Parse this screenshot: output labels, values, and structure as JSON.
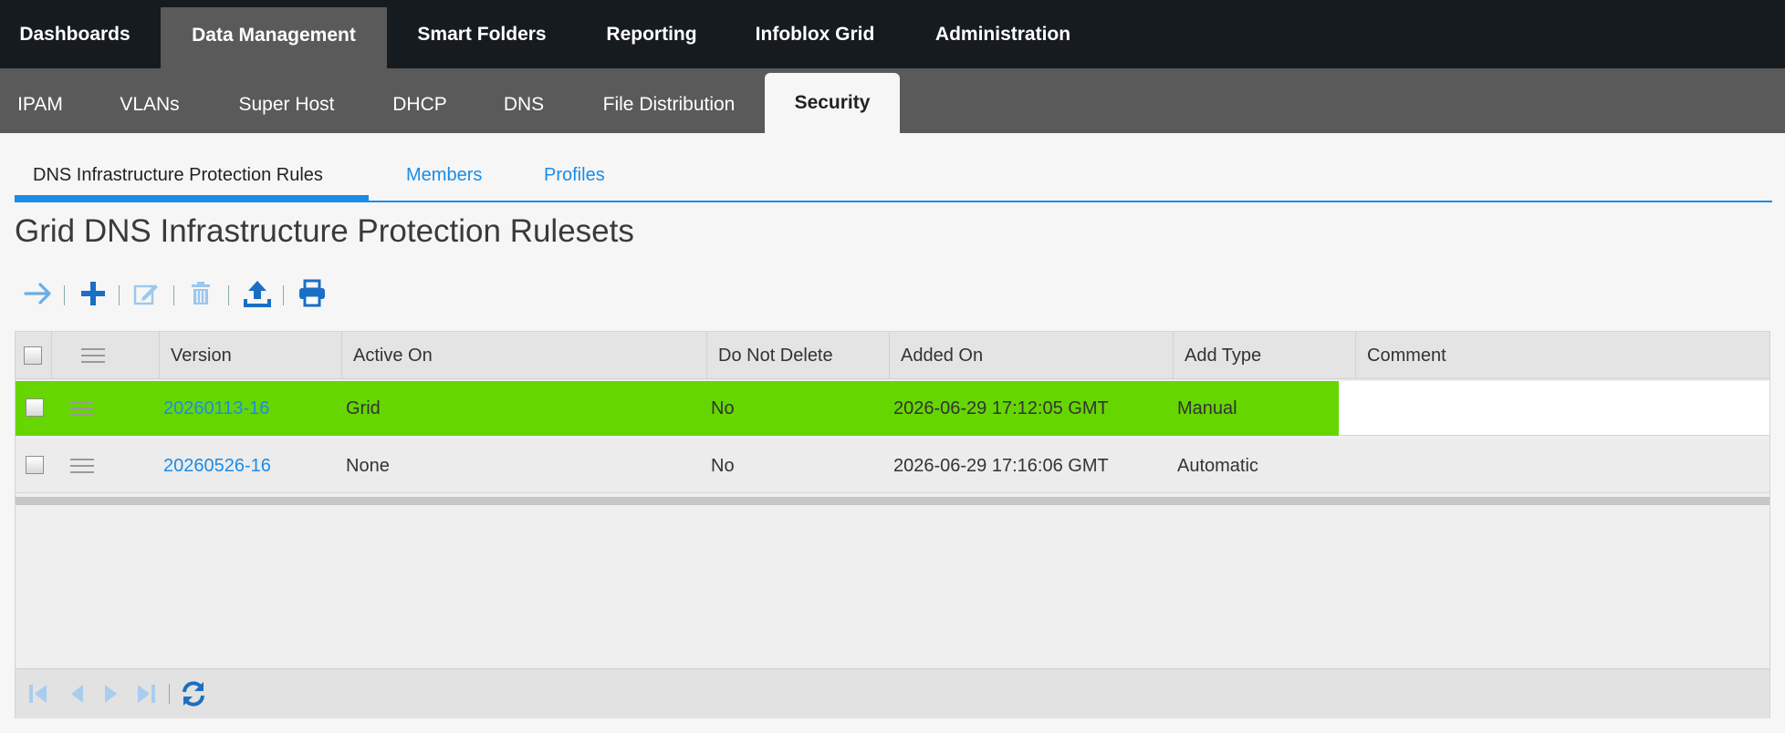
{
  "top_nav": {
    "tabs": [
      "Dashboards",
      "Data Management",
      "Smart Folders",
      "Reporting",
      "Infoblox Grid",
      "Administration"
    ],
    "active": "Data Management"
  },
  "sub_nav": {
    "tabs": [
      "IPAM",
      "VLANs",
      "Super Host",
      "DHCP",
      "DNS",
      "File Distribution",
      "Security"
    ],
    "active": "Security"
  },
  "section_tabs": {
    "tabs": [
      "DNS Infrastructure Protection Rules",
      "Members",
      "Profiles"
    ],
    "active": "DNS Infrastructure Protection Rules"
  },
  "page_title": "Grid DNS Infrastructure Protection Rulesets",
  "toolbar": {
    "icons": [
      "arrow-right-icon",
      "plus-icon",
      "edit-icon",
      "trash-icon",
      "upload-icon",
      "print-icon"
    ]
  },
  "table": {
    "columns": [
      "Version",
      "Active On",
      "Do Not Delete",
      "Added On",
      "Add Type",
      "Comment"
    ],
    "rows": [
      {
        "version": "20260113-16",
        "active_on": "Grid",
        "do_not_delete": "No",
        "added_on": "2026-06-29 17:12:05 GMT",
        "add_type": "Manual",
        "comment": "",
        "highlighted": true
      },
      {
        "version": "20260526-16",
        "active_on": "None",
        "do_not_delete": "No",
        "added_on": "2026-06-29 17:16:06 GMT",
        "add_type": "Automatic",
        "comment": "",
        "highlighted": false
      }
    ]
  },
  "pager": {
    "icons": [
      "first-page-icon",
      "prev-page-icon",
      "next-page-icon",
      "last-page-icon",
      "refresh-icon"
    ]
  },
  "colors": {
    "accent": "#1a8ce8",
    "active_row": "#66d600",
    "top_nav_bg": "#161b20",
    "sub_nav_bg": "#5a5a5a"
  }
}
